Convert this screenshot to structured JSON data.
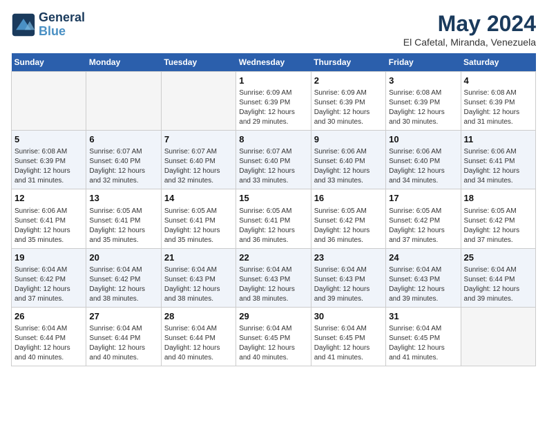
{
  "header": {
    "logo_line1": "General",
    "logo_line2": "Blue",
    "month": "May 2024",
    "location": "El Cafetal, Miranda, Venezuela"
  },
  "weekdays": [
    "Sunday",
    "Monday",
    "Tuesday",
    "Wednesday",
    "Thursday",
    "Friday",
    "Saturday"
  ],
  "weeks": [
    [
      {
        "day": "",
        "empty": true
      },
      {
        "day": "",
        "empty": true
      },
      {
        "day": "",
        "empty": true
      },
      {
        "day": "1",
        "sunrise": "6:09 AM",
        "sunset": "6:39 PM",
        "daylight": "12 hours and 29 minutes."
      },
      {
        "day": "2",
        "sunrise": "6:09 AM",
        "sunset": "6:39 PM",
        "daylight": "12 hours and 30 minutes."
      },
      {
        "day": "3",
        "sunrise": "6:08 AM",
        "sunset": "6:39 PM",
        "daylight": "12 hours and 30 minutes."
      },
      {
        "day": "4",
        "sunrise": "6:08 AM",
        "sunset": "6:39 PM",
        "daylight": "12 hours and 31 minutes."
      }
    ],
    [
      {
        "day": "5",
        "sunrise": "6:08 AM",
        "sunset": "6:39 PM",
        "daylight": "12 hours and 31 minutes."
      },
      {
        "day": "6",
        "sunrise": "6:07 AM",
        "sunset": "6:40 PM",
        "daylight": "12 hours and 32 minutes."
      },
      {
        "day": "7",
        "sunrise": "6:07 AM",
        "sunset": "6:40 PM",
        "daylight": "12 hours and 32 minutes."
      },
      {
        "day": "8",
        "sunrise": "6:07 AM",
        "sunset": "6:40 PM",
        "daylight": "12 hours and 33 minutes."
      },
      {
        "day": "9",
        "sunrise": "6:06 AM",
        "sunset": "6:40 PM",
        "daylight": "12 hours and 33 minutes."
      },
      {
        "day": "10",
        "sunrise": "6:06 AM",
        "sunset": "6:40 PM",
        "daylight": "12 hours and 34 minutes."
      },
      {
        "day": "11",
        "sunrise": "6:06 AM",
        "sunset": "6:41 PM",
        "daylight": "12 hours and 34 minutes."
      }
    ],
    [
      {
        "day": "12",
        "sunrise": "6:06 AM",
        "sunset": "6:41 PM",
        "daylight": "12 hours and 35 minutes."
      },
      {
        "day": "13",
        "sunrise": "6:05 AM",
        "sunset": "6:41 PM",
        "daylight": "12 hours and 35 minutes."
      },
      {
        "day": "14",
        "sunrise": "6:05 AM",
        "sunset": "6:41 PM",
        "daylight": "12 hours and 35 minutes."
      },
      {
        "day": "15",
        "sunrise": "6:05 AM",
        "sunset": "6:41 PM",
        "daylight": "12 hours and 36 minutes."
      },
      {
        "day": "16",
        "sunrise": "6:05 AM",
        "sunset": "6:42 PM",
        "daylight": "12 hours and 36 minutes."
      },
      {
        "day": "17",
        "sunrise": "6:05 AM",
        "sunset": "6:42 PM",
        "daylight": "12 hours and 37 minutes."
      },
      {
        "day": "18",
        "sunrise": "6:05 AM",
        "sunset": "6:42 PM",
        "daylight": "12 hours and 37 minutes."
      }
    ],
    [
      {
        "day": "19",
        "sunrise": "6:04 AM",
        "sunset": "6:42 PM",
        "daylight": "12 hours and 37 minutes."
      },
      {
        "day": "20",
        "sunrise": "6:04 AM",
        "sunset": "6:42 PM",
        "daylight": "12 hours and 38 minutes."
      },
      {
        "day": "21",
        "sunrise": "6:04 AM",
        "sunset": "6:43 PM",
        "daylight": "12 hours and 38 minutes."
      },
      {
        "day": "22",
        "sunrise": "6:04 AM",
        "sunset": "6:43 PM",
        "daylight": "12 hours and 38 minutes."
      },
      {
        "day": "23",
        "sunrise": "6:04 AM",
        "sunset": "6:43 PM",
        "daylight": "12 hours and 39 minutes."
      },
      {
        "day": "24",
        "sunrise": "6:04 AM",
        "sunset": "6:43 PM",
        "daylight": "12 hours and 39 minutes."
      },
      {
        "day": "25",
        "sunrise": "6:04 AM",
        "sunset": "6:44 PM",
        "daylight": "12 hours and 39 minutes."
      }
    ],
    [
      {
        "day": "26",
        "sunrise": "6:04 AM",
        "sunset": "6:44 PM",
        "daylight": "12 hours and 40 minutes."
      },
      {
        "day": "27",
        "sunrise": "6:04 AM",
        "sunset": "6:44 PM",
        "daylight": "12 hours and 40 minutes."
      },
      {
        "day": "28",
        "sunrise": "6:04 AM",
        "sunset": "6:44 PM",
        "daylight": "12 hours and 40 minutes."
      },
      {
        "day": "29",
        "sunrise": "6:04 AM",
        "sunset": "6:45 PM",
        "daylight": "12 hours and 40 minutes."
      },
      {
        "day": "30",
        "sunrise": "6:04 AM",
        "sunset": "6:45 PM",
        "daylight": "12 hours and 41 minutes."
      },
      {
        "day": "31",
        "sunrise": "6:04 AM",
        "sunset": "6:45 PM",
        "daylight": "12 hours and 41 minutes."
      },
      {
        "day": "",
        "empty": true
      }
    ]
  ]
}
